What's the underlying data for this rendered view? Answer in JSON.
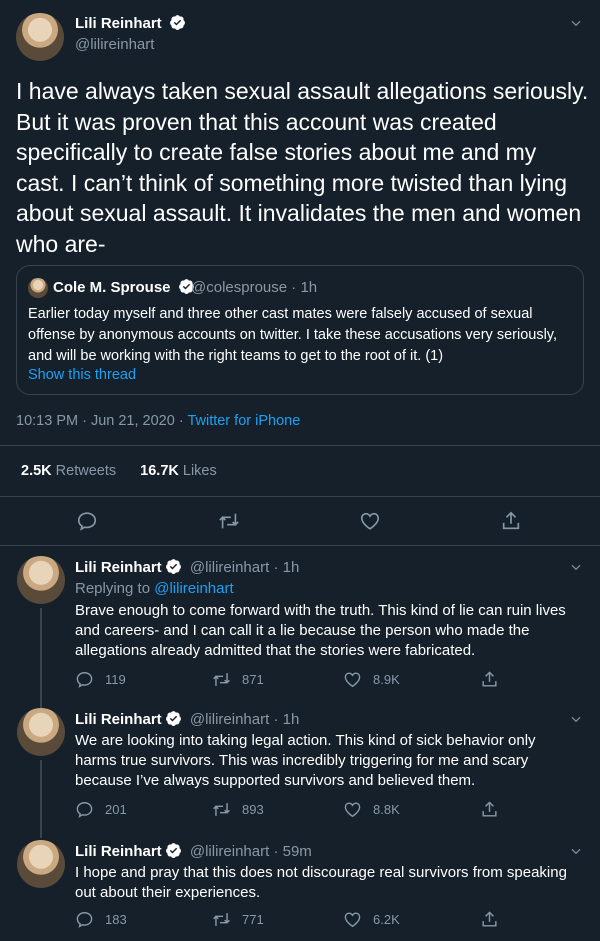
{
  "main_tweet": {
    "name": "Lili Reinhart",
    "handle": "@lilireinhart",
    "text": "I have always taken sexual assault allegations seriously. But it was proven that this account was created specifically to create false stories about me and my cast. I can’t think of something more twisted than lying about sexual assault. It invalidates the men and women who are-",
    "quote": {
      "name": "Cole M. Sprouse",
      "handle_time": "@colesprouse · 1h",
      "text": "Earlier today myself and three other cast mates were falsely accused of sexual offense by anonymous accounts on twitter. I take these accusations very seriously, and will be working with the right teams to get to the root of it. (1)",
      "show_thread": "Show this thread"
    },
    "timestamp": "10:13 PM · Jun 21, 2020 · ",
    "source": "Twitter for iPhone",
    "retweets_count": "2.5K",
    "retweets_label": " Retweets",
    "likes_count": "16.7K",
    "likes_label": " Likes"
  },
  "replies": [
    {
      "name": "Lili Reinhart",
      "handle_time": "@lilireinhart · 1h",
      "replying_prefix": "Replying to ",
      "replying_to": "@lilireinhart",
      "text": "Brave enough to come forward with the truth. This kind of lie can ruin lives and careers- and I can call it a lie because the person who made the allegations already admitted that the stories were fabricated.",
      "replies": "119",
      "retweets": "871",
      "likes": "8.9K"
    },
    {
      "name": "Lili Reinhart",
      "handle_time": "@lilireinhart · 1h",
      "text": "We are looking into taking legal action. This kind of sick behavior only harms true survivors. This was incredibly triggering for me and scary because I’ve always supported survivors and believed them.",
      "replies": "201",
      "retweets": "893",
      "likes": "8.8K"
    },
    {
      "name": "Lili Reinhart",
      "handle_time": "@lilireinhart · 59m",
      "text": "I hope and pray that this does not discourage real survivors from speaking out about their experiences.",
      "replies": "183",
      "retweets": "771",
      "likes": "6.2K"
    }
  ],
  "colors": {
    "background": "#15202b",
    "accent": "#1da1f2",
    "muted": "#8899a6",
    "border": "#38444d"
  }
}
